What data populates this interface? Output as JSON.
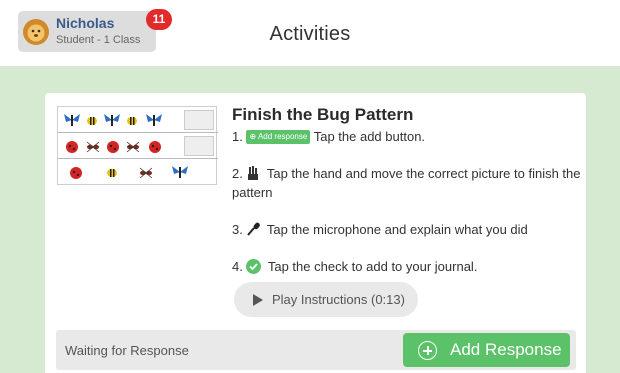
{
  "header": {
    "title": "Activities",
    "user": {
      "name": "Nicholas",
      "subtitle": "Student - 1 Class",
      "notification_count": "11",
      "avatar_icon": "lion-avatar-icon"
    }
  },
  "activity": {
    "title": "Finish the Bug Pattern",
    "steps": {
      "s1_prefix": "1.",
      "s1_button": "Add response",
      "s1_text": "Tap the add button.",
      "s2_prefix": "2.",
      "s2_text": "Tap the hand and move the correct picture to finish the pattern",
      "s3_prefix": "3.",
      "s3_text": "Tap the microphone and explain what you did",
      "s4_prefix": "4.",
      "s4_text": "Tap the check to add to your journal."
    },
    "play_label": "Play Instructions (0:13)",
    "status": "Waiting for Response",
    "add_label": "Add Response"
  },
  "colors": {
    "background": "#d6ead1",
    "accent_green": "#5cc269",
    "badge_red": "#e22a2a",
    "user_name": "#3b5b8a"
  }
}
